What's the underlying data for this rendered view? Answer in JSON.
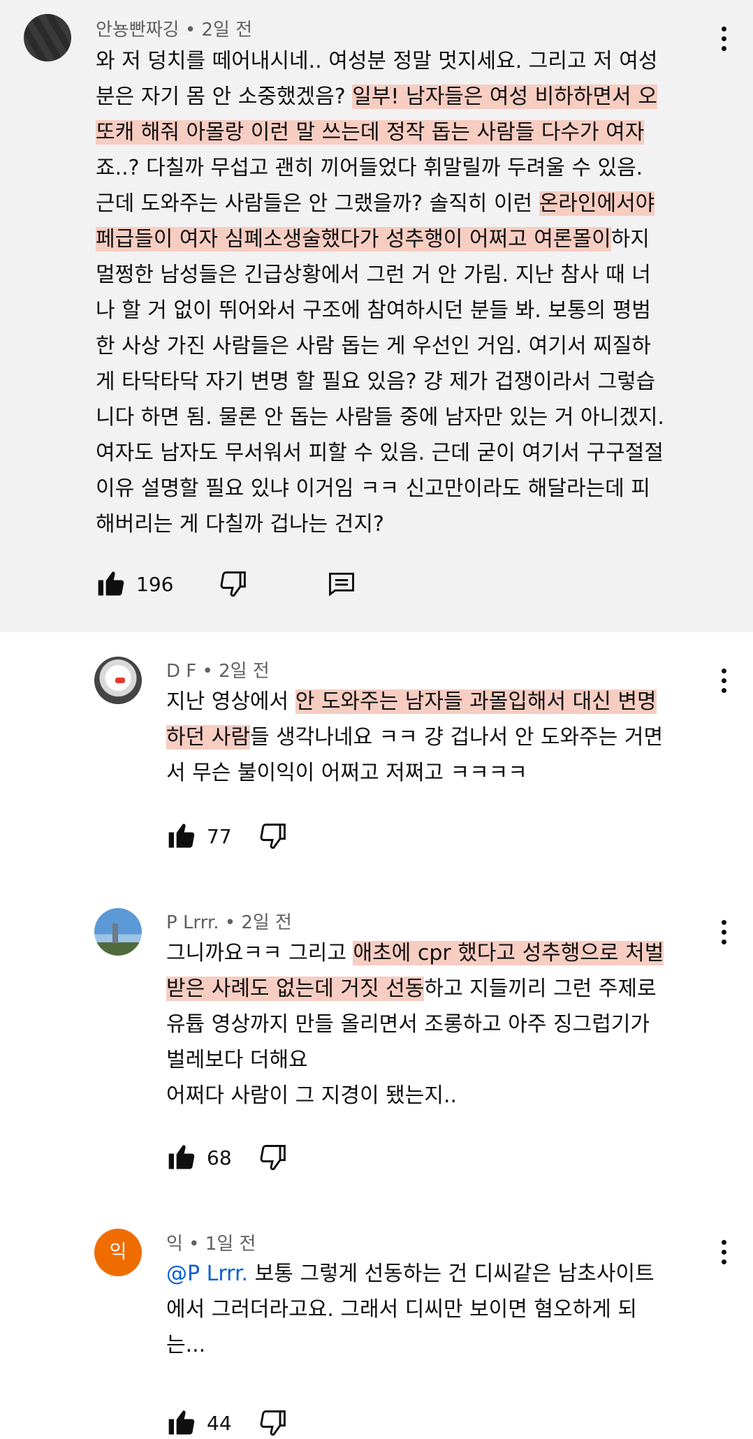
{
  "comments": [
    {
      "author": "안뇽빤짜깅",
      "time": "2일 전",
      "meta": "안뇽빤짜깅 • 2일 전",
      "lines": [
        [
          {
            "t": "와 저 덩치를 떼어내시네.. 여성분 정말 멋지세요. 그리고 저 여성"
          }
        ],
        [
          {
            "t": "분은 자기 몸 안 소중했겠음? "
          },
          {
            "t": "일부! 남자들은 여성 비하하면서 오",
            "h": true
          }
        ],
        [
          {
            "t": "또캐 해줘 아몰랑 이런 말 쓰는데 정작 돕는 사람들 다수가 여자",
            "h": true
          }
        ],
        [
          {
            "t": "죠..? 다칠까 무섭고 괜히 끼어들었다 휘말릴까 두려울 수 있음."
          }
        ],
        [
          {
            "t": "근데 도와주는 사람들은 안 그랬을까? 솔직히 이런 "
          },
          {
            "t": "온라인에서야",
            "h": true
          }
        ],
        [
          {
            "t": "페급들이 여자 심폐소생술했다가 성추행이 어쩌고 여론몰이",
            "h": true
          },
          {
            "t": "하지"
          }
        ],
        [
          {
            "t": "멀쩡한 남성들은 긴급상황에서 그런 거 안 가림. 지난 참사 때 너"
          }
        ],
        [
          {
            "t": "나 할 거 없이 뛰어와서 구조에 참여하시던 분들 봐. 보통의 평범"
          }
        ],
        [
          {
            "t": "한 사상 가진 사람들은 사람 돕는 게 우선인 거임. 여기서 찌질하"
          }
        ],
        [
          {
            "t": "게 타닥타닥 자기 변명 할 필요 있음? 걍 제가 겁쟁이라서 그렇습"
          }
        ],
        [
          {
            "t": "니다 하면 됨. 물론 안 돕는 사람들 중에 남자만 있는 거 아니겠지."
          }
        ],
        [
          {
            "t": "여자도 남자도 무서워서 피할 수 있음. 근데 굳이 여기서 구구절절"
          }
        ],
        [
          {
            "t": "이유 설명할 필요 있냐 이거임 ㅋㅋ 신고만이라도 해달라는데 피"
          }
        ],
        [
          {
            "t": "해버리는 게 다칠까 겁나는 건지?"
          }
        ]
      ],
      "likes": "196"
    },
    {
      "author": "D F",
      "time": "2일 전",
      "meta": "D F • 2일 전",
      "lines": [
        [
          {
            "t": "지난 영상에서 "
          },
          {
            "t": "안 도와주는 남자들 과몰입해서 대신 변명",
            "h": true
          }
        ],
        [
          {
            "t": "하던 사람",
            "h": true
          },
          {
            "t": "들 생각나네요 ㅋㅋ 걍 겁나서 안 도와주는 거면"
          }
        ],
        [
          {
            "t": "서 무슨 불이익이 어쩌고 저쩌고 ㅋㅋㅋㅋ"
          }
        ]
      ],
      "likes": "77"
    },
    {
      "author": "P Lrrr.",
      "time": "2일 전",
      "meta": "P Lrrr. • 2일 전",
      "lines": [
        [
          {
            "t": "그니까요ㅋㅋ 그리고 "
          },
          {
            "t": "애초에 cpr 했다고 성추행으로 처벌",
            "h": true
          }
        ],
        [
          {
            "t": "받은 사례도 없는데 거짓 선동",
            "h": true
          },
          {
            "t": "하고 지들끼리 그런 주제로"
          }
        ],
        [
          {
            "t": "유튭 영상까지 만들 올리면서 조롱하고 아주 징그럽기가"
          }
        ],
        [
          {
            "t": "벌레보다 더해요"
          }
        ],
        [
          {
            "t": "어쩌다 사람이 그 지경이 됐는지.."
          }
        ]
      ],
      "likes": "68"
    },
    {
      "author": "익",
      "time": "1일 전",
      "meta": "익 • 1일 전",
      "avatar_letter": "익",
      "lines": [
        [
          {
            "t": " @P Lrrr.",
            "m": true
          },
          {
            "t": "  보통 그렇게 선동하는 건 디씨같은 남초사이트"
          }
        ],
        [
          {
            "t": "에서 그러더라고요. 그래서 디씨만 보이면 혐오하게 되"
          }
        ],
        [
          {
            "t": "는..."
          }
        ]
      ],
      "likes": "44"
    }
  ],
  "icons": {
    "like": "thumbs-up-icon",
    "dislike": "thumbs-down-icon",
    "reply": "reply-comment-icon",
    "menu": "more-vertical-icon"
  },
  "colors": {
    "highlight": "#f7cdc2",
    "mention": "#065fd4",
    "pinned_bg": "#f2f2f2",
    "avatar_orange": "#ef6c00"
  }
}
